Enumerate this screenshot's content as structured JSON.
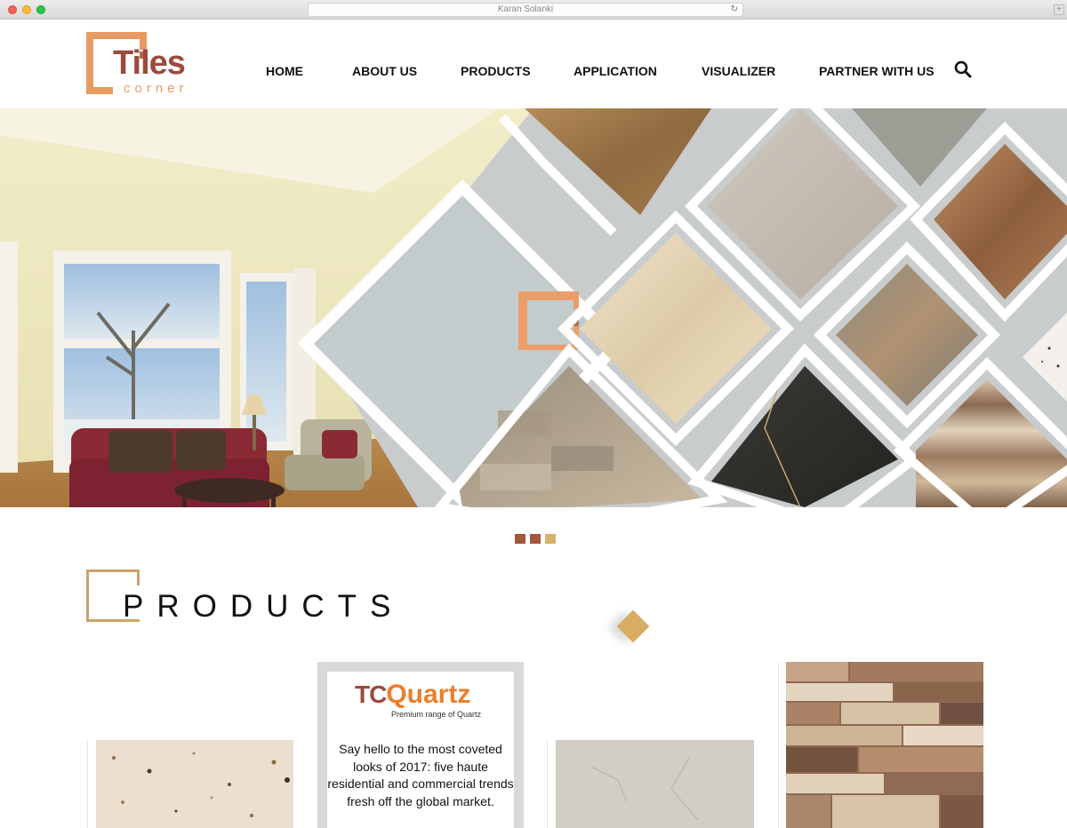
{
  "browser": {
    "title": "Karan Solanki",
    "newtab_label": "+"
  },
  "brand": {
    "name_main": "Tiles",
    "name_sub": "corner"
  },
  "nav": {
    "items": [
      {
        "label": "HOME"
      },
      {
        "label": "ABOUT US"
      },
      {
        "label": "PRODUCTS"
      },
      {
        "label": "APPLICATION"
      },
      {
        "label": "VISUALIZER"
      },
      {
        "label": "PARTNER WITH US"
      }
    ]
  },
  "slider": {
    "dot_colors": [
      "#a8553f",
      "#a8553f",
      "#d4b26c"
    ]
  },
  "products": {
    "heading": "PRODUCTS",
    "accent_color": "#c9a46a",
    "featured": {
      "logo_tc": "TC",
      "logo_quartz": "Quartz",
      "tagline": "Premium range of Quartz",
      "description": "Say hello to the most coveted looks of 2017: five haute residential and commercial trends fresh off the global market."
    }
  },
  "colors": {
    "brand_primary": "#9b4a3e",
    "brand_secondary": "#e89a63",
    "quartz_orange": "#e8802f"
  }
}
